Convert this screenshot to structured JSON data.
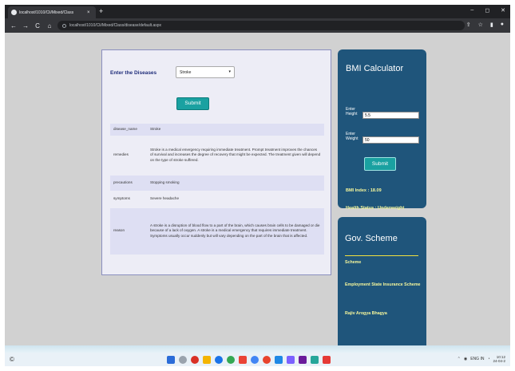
{
  "browser": {
    "tab_title": "localhost/1010/Cli/Mixed/Class",
    "tab_close": "×",
    "new_tab": "+",
    "url": "localhost/1010/Cli/Mixed/Class/disease/default.aspx",
    "nav": {
      "back": "←",
      "forward": "→",
      "reload": "C",
      "home": "⌂"
    },
    "window": {
      "minimize": "–",
      "maximize": "◻",
      "close": "✕"
    }
  },
  "disease": {
    "label": "Enter the Diseases",
    "selected": "Stroke",
    "submit_label": "Submit",
    "rows": [
      {
        "key": "disease_name",
        "value": "Stroke"
      },
      {
        "key": "remedies",
        "value": "Stroke is a medical emergency requiring immediate treatment. Prompt treatment improves the chances of survival and increases the degree of recovery that might be expected. The treatment given will depend on the type of stroke suffered."
      },
      {
        "key": "precautions",
        "value": "Stopping smoking"
      },
      {
        "key": "symptoms",
        "value": "Severe headache"
      },
      {
        "key": "reason",
        "value": "A stroke is a disruption of blood flow to a part of the brain, which causes brain cells to be damaged or die because of a lack of oxygen. A stroke is a medical emergency that requires immediate treatment. Symptoms usually occur suddenly but will vary depending on the part of the brain that is affected."
      }
    ]
  },
  "bmi": {
    "title": "BMI Calculator",
    "height_label": "Enter Height",
    "height_value": "5.5",
    "weight_label": "Enter Weight",
    "weight_value": "50",
    "submit_label": "Submit",
    "index_text": "BMI Index : 18.09",
    "status_text": "Health Status : Underweight"
  },
  "gov": {
    "title": "Gov. Scheme",
    "links": [
      "Scheme",
      "Employment State Insurance Scheme",
      "Rajiv Arogya Bhagya"
    ]
  },
  "taskbar": {
    "search_glyph": "©",
    "time": "10:12",
    "date": "24-04-2",
    "lang": "ENG IN"
  },
  "colors": {
    "panel_blue": "#1f557b",
    "button_teal": "#1aa1a1",
    "highlight_yellow": "#f6f79c"
  }
}
